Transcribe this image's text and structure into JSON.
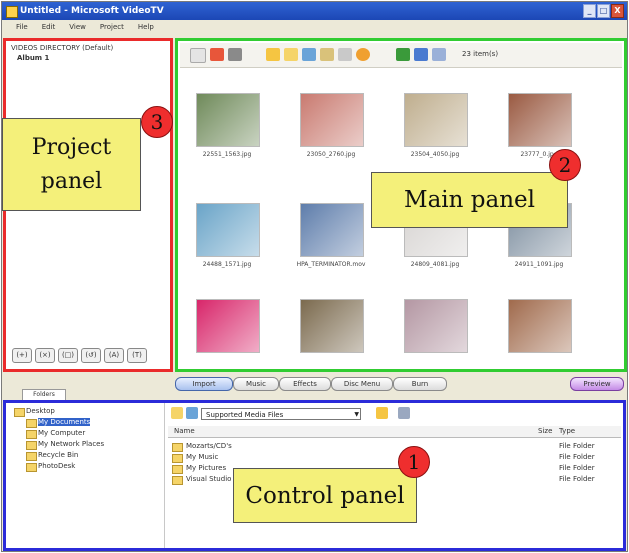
{
  "window": {
    "title": "Untitled - Microsoft VideoTV",
    "buttons": [
      "_",
      "□",
      "X"
    ]
  },
  "menu": [
    "File",
    "Edit",
    "View",
    "Project",
    "Help"
  ],
  "project_panel": {
    "tree_root": "VIDEOS DIRECTORY (Default)",
    "album": "Album 1",
    "tool_buttons": [
      "(+)",
      "(×)",
      "(□)",
      "(↺)",
      "(A)",
      "(T)"
    ]
  },
  "main_panel": {
    "item_count": "23 item(s)",
    "thumbnails": [
      {
        "caption": "22551_1563.jpg",
        "color": "#6f8a5a"
      },
      {
        "caption": "23050_2760.jpg",
        "color": "#c97a70"
      },
      {
        "caption": "23504_4050.jpg",
        "color": "#bfae8e"
      },
      {
        "caption": "23777_0.jpg",
        "color": "#9a5a42"
      },
      {
        "caption": "24488_1571.jpg",
        "color": "#6aa4c8"
      },
      {
        "caption": "HPA_TERMINATOR.mov",
        "color": "#5e7dab"
      },
      {
        "caption": "24809_4081.jpg",
        "color": "#d7d4d2"
      },
      {
        "caption": "24911_1091.jpg",
        "color": "#7e8fa0"
      },
      {
        "caption": "",
        "color": "#d8266a"
      },
      {
        "caption": "",
        "color": "#7b6a4e"
      },
      {
        "caption": "",
        "color": "#b497a3"
      },
      {
        "caption": "",
        "color": "#a06a4c"
      }
    ]
  },
  "navigation": {
    "buttons": [
      "Import",
      "Music",
      "Effects",
      "Disc Menu",
      "Burn"
    ],
    "preview": "Preview",
    "folder_tab": "Folders"
  },
  "control_panel": {
    "tree": [
      {
        "label": "Desktop",
        "indent": 0,
        "selected": false
      },
      {
        "label": "My Documents",
        "indent": 1,
        "selected": true
      },
      {
        "label": "My Computer",
        "indent": 1,
        "selected": false
      },
      {
        "label": "My Network Places",
        "indent": 1,
        "selected": false
      },
      {
        "label": "Recycle Bin",
        "indent": 1,
        "selected": false
      },
      {
        "label": "PhotoDesk",
        "indent": 1,
        "selected": false
      }
    ],
    "filter": "Supported Media Files",
    "columns": {
      "name": "Name",
      "size": "Size",
      "type": "Type"
    },
    "rows": [
      {
        "name": "Mozarts/CD's",
        "type": "File Folder"
      },
      {
        "name": "My Music",
        "type": "File Folder"
      },
      {
        "name": "My Pictures",
        "type": "File Folder"
      },
      {
        "name": "Visual Studio",
        "type": "File Folder"
      }
    ]
  },
  "annotations": [
    {
      "number": "1",
      "label": "Control panel"
    },
    {
      "number": "2",
      "label": "Main panel"
    },
    {
      "number": "3",
      "label": "Project panel"
    }
  ],
  "colors": {
    "control_border": "#2b2bd9",
    "main_border": "#31cc31",
    "project_border": "#ea2b2b",
    "callout_fill": "#f4f07a",
    "badge_fill": "#ef2e2e"
  }
}
